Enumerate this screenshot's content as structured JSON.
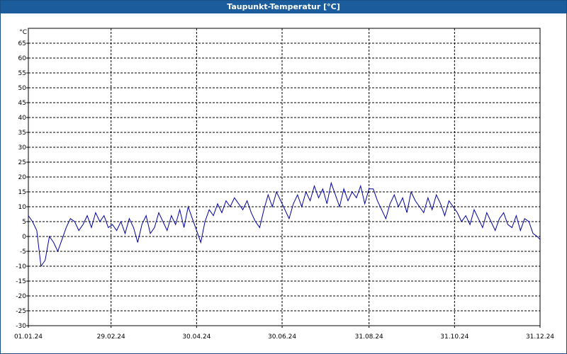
{
  "window": {
    "title": "Taupunkt-Temperatur [°C]"
  },
  "colors": {
    "series": "#0000a0",
    "grid": "#000000",
    "titlebar": "#1b5d9c"
  },
  "chart_data": {
    "type": "line",
    "title": "Taupunkt-Temperatur [°C]",
    "ylabel": "°C",
    "ylim": [
      -30,
      70
    ],
    "yticks": [
      -30,
      -25,
      -20,
      -15,
      -10,
      -5,
      0,
      5,
      10,
      15,
      20,
      25,
      30,
      35,
      40,
      45,
      50,
      55,
      60,
      65
    ],
    "xlim": [
      "2024-01-01",
      "2024-12-31"
    ],
    "xticks": [
      {
        "date": "2024-01-01",
        "label": "01.01.24"
      },
      {
        "date": "2024-02-29",
        "label": "29.02.24"
      },
      {
        "date": "2024-04-30",
        "label": "30.04.24"
      },
      {
        "date": "2024-06-30",
        "label": "30.06.24"
      },
      {
        "date": "2024-08-31",
        "label": "31.08.24"
      },
      {
        "date": "2024-10-31",
        "label": "31.10.24"
      },
      {
        "date": "2024-12-31",
        "label": "31.12.24"
      }
    ],
    "grid": true,
    "series": [
      {
        "x": [
          "2024-01-01",
          "2024-01-04",
          "2024-01-07",
          "2024-01-10",
          "2024-01-13",
          "2024-01-16",
          "2024-01-19",
          "2024-01-22",
          "2024-01-25",
          "2024-01-28",
          "2024-01-31",
          "2024-02-03",
          "2024-02-06",
          "2024-02-09",
          "2024-02-12",
          "2024-02-15",
          "2024-02-18",
          "2024-02-21",
          "2024-02-24",
          "2024-02-27",
          "2024-03-01",
          "2024-03-04",
          "2024-03-07",
          "2024-03-10",
          "2024-03-13",
          "2024-03-16",
          "2024-03-19",
          "2024-03-22",
          "2024-03-25",
          "2024-03-28",
          "2024-03-31",
          "2024-04-03",
          "2024-04-06",
          "2024-04-09",
          "2024-04-12",
          "2024-04-15",
          "2024-04-18",
          "2024-04-21",
          "2024-04-24",
          "2024-04-27",
          "2024-04-30",
          "2024-05-03",
          "2024-05-06",
          "2024-05-09",
          "2024-05-12",
          "2024-05-15",
          "2024-05-18",
          "2024-05-21",
          "2024-05-24",
          "2024-05-27",
          "2024-05-30",
          "2024-06-02",
          "2024-06-05",
          "2024-06-08",
          "2024-06-11",
          "2024-06-14",
          "2024-06-17",
          "2024-06-20",
          "2024-06-23",
          "2024-06-26",
          "2024-06-29",
          "2024-07-02",
          "2024-07-05",
          "2024-07-08",
          "2024-07-11",
          "2024-07-14",
          "2024-07-17",
          "2024-07-20",
          "2024-07-23",
          "2024-07-26",
          "2024-07-29",
          "2024-08-01",
          "2024-08-04",
          "2024-08-07",
          "2024-08-10",
          "2024-08-13",
          "2024-08-16",
          "2024-08-19",
          "2024-08-22",
          "2024-08-25",
          "2024-08-28",
          "2024-08-31",
          "2024-09-03",
          "2024-09-06",
          "2024-09-09",
          "2024-09-12",
          "2024-09-15",
          "2024-09-18",
          "2024-09-21",
          "2024-09-24",
          "2024-09-27",
          "2024-09-30",
          "2024-10-03",
          "2024-10-06",
          "2024-10-09",
          "2024-10-12",
          "2024-10-15",
          "2024-10-18",
          "2024-10-21",
          "2024-10-24",
          "2024-10-27",
          "2024-10-30",
          "2024-11-02",
          "2024-11-05",
          "2024-11-08",
          "2024-11-11",
          "2024-11-14",
          "2024-11-17",
          "2024-11-20",
          "2024-11-23",
          "2024-11-26",
          "2024-11-29",
          "2024-12-02",
          "2024-12-05",
          "2024-12-08",
          "2024-12-11",
          "2024-12-14",
          "2024-12-17",
          "2024-12-20",
          "2024-12-23",
          "2024-12-26",
          "2024-12-29",
          "2024-12-31"
        ],
        "y": [
          7,
          5,
          2,
          -10,
          -8,
          0,
          -2,
          -5,
          -1,
          3,
          6,
          5,
          2,
          4,
          7,
          3,
          8,
          5,
          7,
          3,
          4,
          2,
          5,
          1,
          6,
          3,
          -2,
          4,
          7,
          1,
          3,
          8,
          5,
          2,
          7,
          4,
          9,
          3,
          10,
          6,
          2,
          -2,
          5,
          9,
          7,
          11,
          8,
          12,
          10,
          13,
          11,
          9,
          12,
          8,
          5,
          3,
          9,
          14,
          10,
          15,
          12,
          9,
          6,
          11,
          14,
          10,
          15,
          12,
          17,
          13,
          16,
          11,
          18,
          14,
          10,
          16,
          12,
          15,
          13,
          17,
          11,
          16,
          16,
          12,
          9,
          6,
          11,
          14,
          10,
          13,
          8,
          15,
          12,
          10,
          8,
          13,
          9,
          14,
          11,
          7,
          12,
          10,
          8,
          5,
          7,
          4,
          9,
          6,
          3,
          8,
          5,
          2,
          6,
          8,
          4,
          3,
          7,
          2,
          6,
          5,
          1,
          0,
          -1
        ]
      }
    ]
  }
}
